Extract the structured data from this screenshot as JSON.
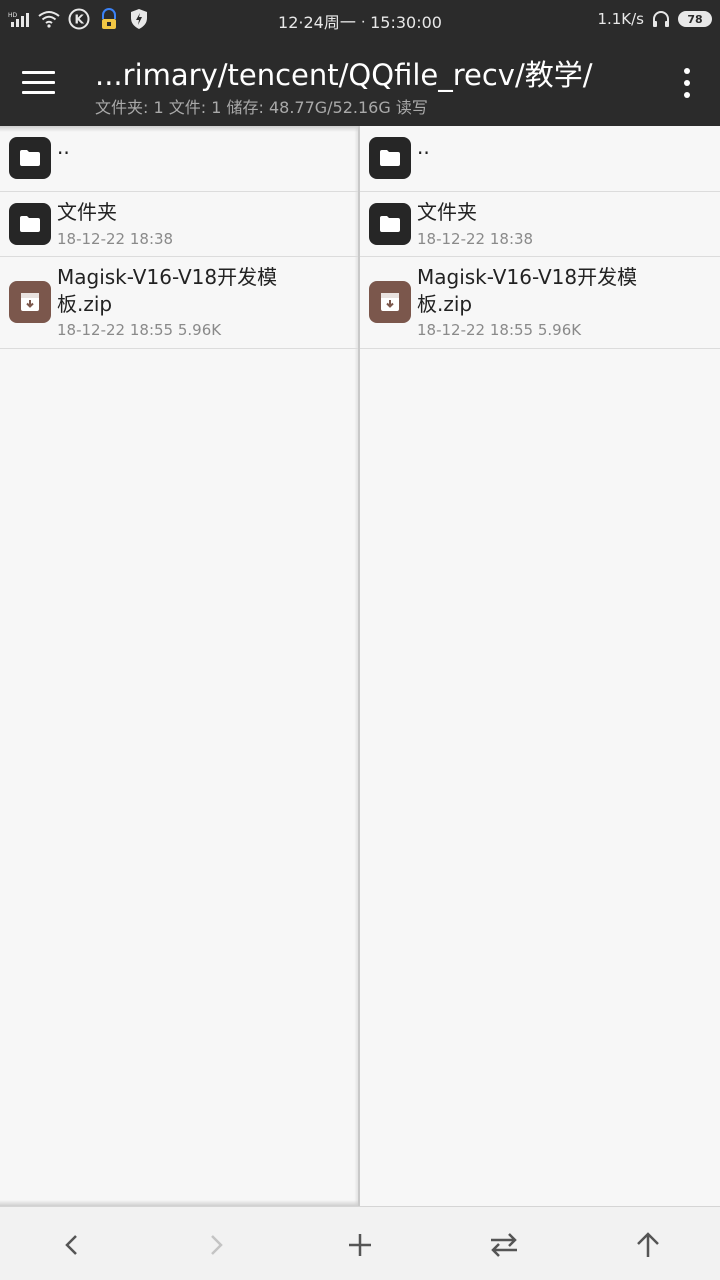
{
  "status_bar": {
    "signal_label": "HD",
    "time_text": "12·24周一 ᐧ 15:30:00",
    "net_speed": "1.1K/s",
    "battery": "78",
    "icons": [
      "signal-icon",
      "wifi-icon",
      "k-app-icon",
      "vpn-lock-icon",
      "shield-bolt-icon",
      "headset-icon"
    ]
  },
  "toolbar": {
    "path_title": "...rimary/tencent/QQfile_recv/教学/",
    "stats": "文件夹: 1  文件: 1  储存: 48.77G/52.16G  读写",
    "menu_icon": "hamburger-menu-icon",
    "more_icon": "more-vert-icon"
  },
  "left_pane": {
    "parent": {
      "name": ".."
    },
    "items": [
      {
        "type": "folder",
        "name": "文件夹",
        "meta": "18-12-22 18:38"
      },
      {
        "type": "zip",
        "name": "Magisk-V16-V18开发模板.zip",
        "meta": "18-12-22 18:55  5.96K"
      }
    ]
  },
  "right_pane": {
    "parent": {
      "name": ".."
    },
    "items": [
      {
        "type": "folder",
        "name": "文件夹",
        "meta": "18-12-22 18:38"
      },
      {
        "type": "zip",
        "name": "Magisk-V16-V18开发模板.zip",
        "meta": "18-12-22 18:55  5.96K"
      }
    ]
  },
  "bottom_bar": {
    "buttons": [
      "back-icon",
      "forward-icon",
      "add-icon",
      "swap-icon",
      "up-arrow-icon"
    ]
  },
  "colors": {
    "bar_bg": "#2b2b2b",
    "folder_icon_bg": "#262626",
    "zip_icon_bg": "#7b574c",
    "pane_bg": "#f7f7f7"
  }
}
